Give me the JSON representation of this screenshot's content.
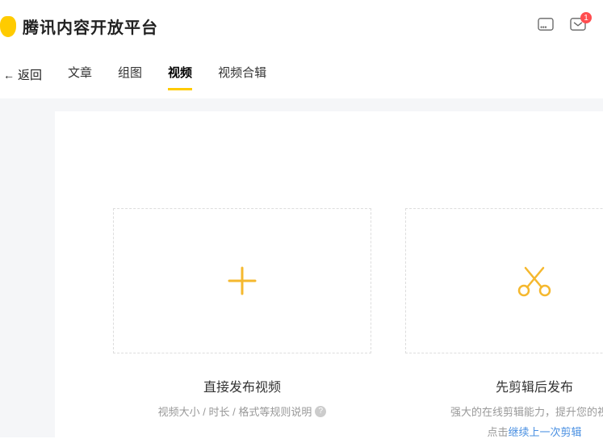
{
  "header": {
    "title": "腾讯内容开放平台",
    "inbox_badge": "1"
  },
  "nav": {
    "back": "返回",
    "tabs": [
      "文章",
      "组图",
      "视频",
      "视频合辑"
    ],
    "active_index": 2
  },
  "cards": {
    "direct": {
      "title": "直接发布视频",
      "desc": "视频大小 / 时长 / 格式等规则说明"
    },
    "edit": {
      "title": "先剪辑后发布",
      "desc": "强大的在线剪辑能力，提升您的视频",
      "desc2_prefix": "点击",
      "desc2_link": "继续上一次剪辑"
    }
  }
}
